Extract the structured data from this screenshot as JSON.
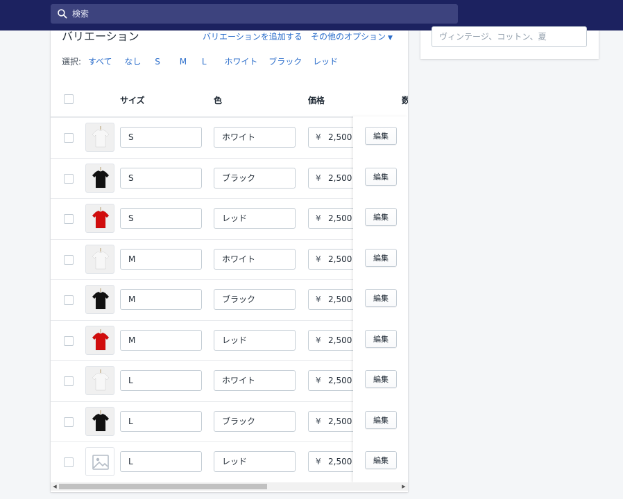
{
  "search": {
    "placeholder": "検索"
  },
  "variants": {
    "title": "バリエーション",
    "add_link": "バリエーションを追加する",
    "more_options": "その他のオプション",
    "select_label": "選択:",
    "select_options": [
      "すべて",
      "なし",
      "S",
      "M",
      "L",
      "ホワイト",
      "ブラック",
      "レッド"
    ],
    "columns": {
      "size": "サイズ",
      "color": "色",
      "price": "価格",
      "quantity_partial": "数"
    },
    "currency": "¥",
    "edit_label": "編集",
    "rows": [
      {
        "size": "S",
        "color": "ホワイト",
        "price": "2,500",
        "image": "white"
      },
      {
        "size": "S",
        "color": "ブラック",
        "price": "2,500",
        "image": "black"
      },
      {
        "size": "S",
        "color": "レッド",
        "price": "2,500",
        "image": "red"
      },
      {
        "size": "M",
        "color": "ホワイト",
        "price": "2,500",
        "image": "white"
      },
      {
        "size": "M",
        "color": "ブラック",
        "price": "2,500",
        "image": "black"
      },
      {
        "size": "M",
        "color": "レッド",
        "price": "2,500",
        "image": "red"
      },
      {
        "size": "L",
        "color": "ホワイト",
        "price": "2,500",
        "image": "white"
      },
      {
        "size": "L",
        "color": "ブラック",
        "price": "2,500",
        "image": "black"
      },
      {
        "size": "L",
        "color": "レッド",
        "price": "2,500",
        "image": "none"
      }
    ]
  },
  "tags": {
    "placeholder": "ヴィンテージ、コットン、夏"
  },
  "colors": {
    "topbar": "#1c2260",
    "link": "#2c6ecb",
    "shirt_white": "#f7f7f7",
    "shirt_black": "#111111",
    "shirt_red": "#d10d0d"
  },
  "icons": {
    "search": "search-icon",
    "caret": "chevron-down-icon",
    "placeholder_image": "image-placeholder-icon"
  }
}
